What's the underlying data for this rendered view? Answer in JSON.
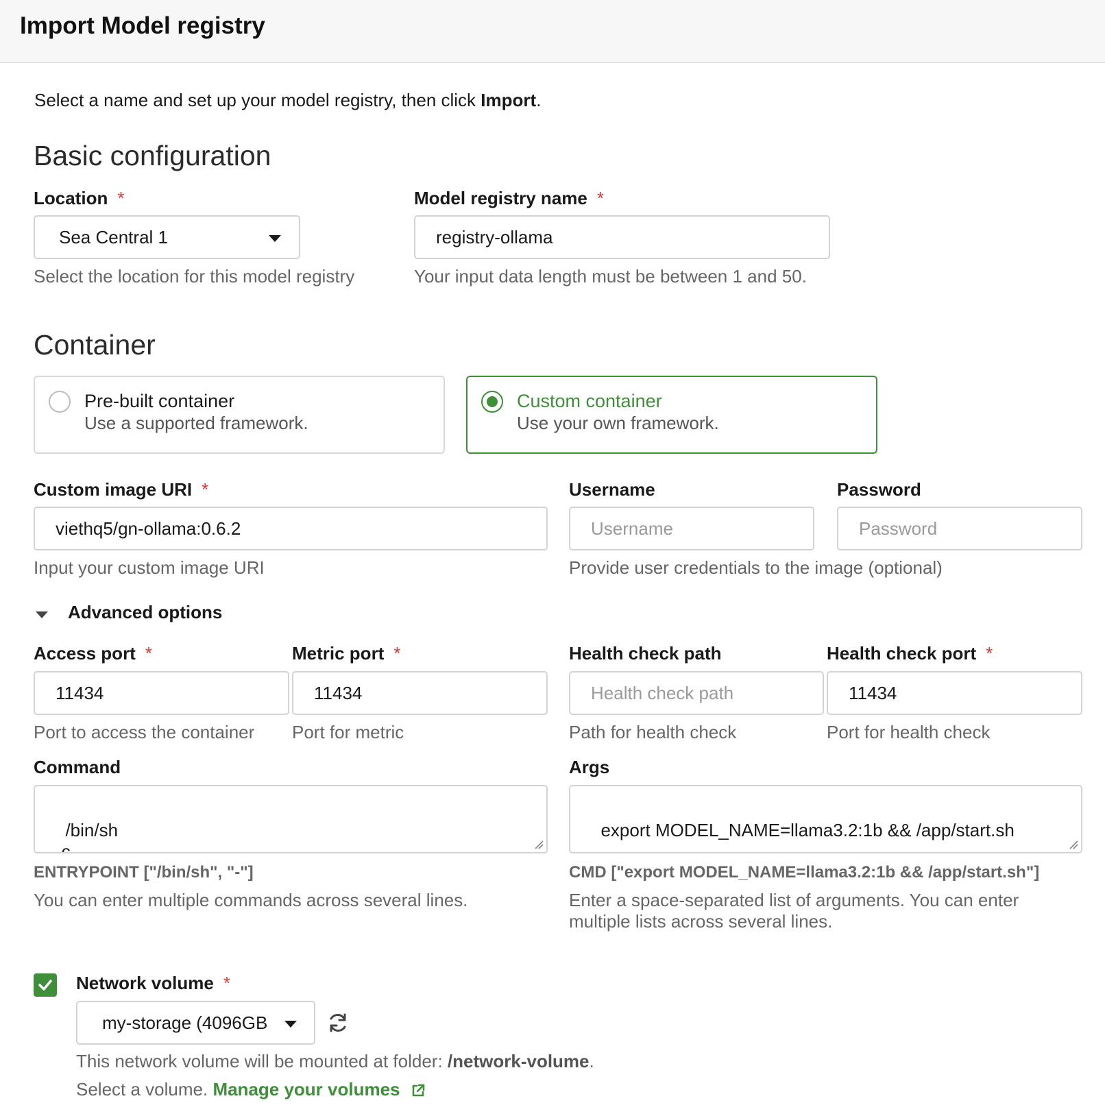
{
  "header": {
    "title": "Import Model registry"
  },
  "intro": {
    "text": "Select a name and set up your model registry, then click ",
    "bold": "Import",
    "end": "."
  },
  "basic": {
    "title": "Basic configuration",
    "location": {
      "label": "Location",
      "required": "*",
      "value": "Sea Central 1",
      "help": "Select the location for this model registry"
    },
    "registry_name": {
      "label": "Model registry name",
      "required": "*",
      "value": "registry-ollama",
      "help": "Your input data length must be between 1 and 50."
    }
  },
  "container": {
    "title": "Container",
    "options": [
      {
        "title": "Pre-built container",
        "subtitle": "Use a supported framework.",
        "selected": false
      },
      {
        "title": "Custom container",
        "subtitle": "Use your own framework.",
        "selected": true
      }
    ],
    "image_uri": {
      "label": "Custom image URI",
      "required": "*",
      "value": "viethq5/gn-ollama:0.6.2",
      "help": "Input your custom image URI"
    },
    "username": {
      "label": "Username",
      "placeholder": "Username"
    },
    "password": {
      "label": "Password",
      "placeholder": "Password"
    },
    "credentials_help": "Provide user credentials to the image (optional)"
  },
  "advanced": {
    "toggle_label": "Advanced options",
    "access_port": {
      "label": "Access port",
      "required": "*",
      "value": "11434",
      "help": "Port to access the container"
    },
    "metric_port": {
      "label": "Metric port",
      "required": "*",
      "value": "11434",
      "help": "Port for metric"
    },
    "health_path": {
      "label": "Health check path",
      "placeholder": "Health check path",
      "help": "Path for health check"
    },
    "health_port": {
      "label": "Health check port",
      "required": "*",
      "value": "11434",
      "help": "Port for health check"
    },
    "command": {
      "label": "Command",
      "value": "/bin/sh\n-c",
      "entrypoint": "ENTRYPOINT [\"/bin/sh\", \"-\"]",
      "help": "You can enter multiple commands across several lines."
    },
    "args": {
      "label": "Args",
      "value": "export MODEL_NAME=llama3.2:1b && /app/start.sh",
      "cmd": "CMD [\"export MODEL_NAME=llama3.2:1b && /app/start.sh\"]",
      "help_line1": "Enter a space-separated list of arguments. You can enter",
      "help_line2": "multiple lists across several lines."
    }
  },
  "network_volume": {
    "label": "Network volume",
    "required": "*",
    "checked": true,
    "value": "my-storage (4096GB",
    "mount_text": "This network volume will be mounted at folder: ",
    "mount_path": "/network-volume",
    "mount_end": ".",
    "select_text": "Select a volume. ",
    "manage_link": "Manage your volumes"
  },
  "colors": {
    "accent": "#3f8f3a",
    "required": "#d93a3a",
    "help": "#666666"
  }
}
